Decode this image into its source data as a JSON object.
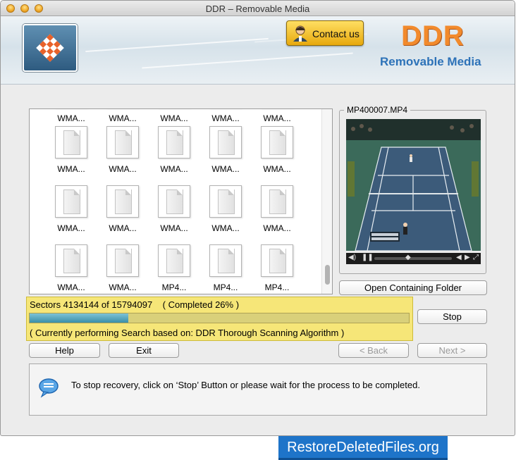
{
  "window": {
    "title": "DDR – Removable Media"
  },
  "header": {
    "contact_label": "Contact us",
    "brand": "DDR",
    "product": "Removable Media"
  },
  "files": {
    "rows": [
      [
        "WMA...",
        "WMA...",
        "WMA...",
        "WMA...",
        "WMA..."
      ],
      [
        "WMA...",
        "WMA...",
        "WMA...",
        "WMA...",
        "WMA..."
      ],
      [
        "WMA...",
        "WMA...",
        "WMA...",
        "WMA...",
        "WMA..."
      ],
      [
        "WMA...",
        "WMA...",
        "MP4...",
        "MP4...",
        "MP4..."
      ]
    ]
  },
  "preview": {
    "filename": "MP400007.MP4",
    "open_folder_label": "Open Containing Folder"
  },
  "progress": {
    "sectors_text": "Sectors 4134144 of 15794097    ( Completed 26% )",
    "percent": 26,
    "status_text": "( Currently performing Search based on: DDR Thorough Scanning Algorithm )",
    "stop_label": "Stop"
  },
  "nav": {
    "help_label": "Help",
    "exit_label": "Exit",
    "back_label": "< Back",
    "next_label": "Next >"
  },
  "info": {
    "message": "To stop recovery, click on ‘Stop’ Button or please wait for the process to be completed."
  },
  "watermark": {
    "text": "RestoreDeletedFiles.org"
  },
  "colors": {
    "accent_orange": "#f28a2c",
    "brand_blue": "#2d72b8",
    "progress_bg": "#f6e678",
    "progress_fill": "#3a8fa8",
    "court": "#3c5b7a",
    "watermark_bg": "#1e74c9"
  }
}
